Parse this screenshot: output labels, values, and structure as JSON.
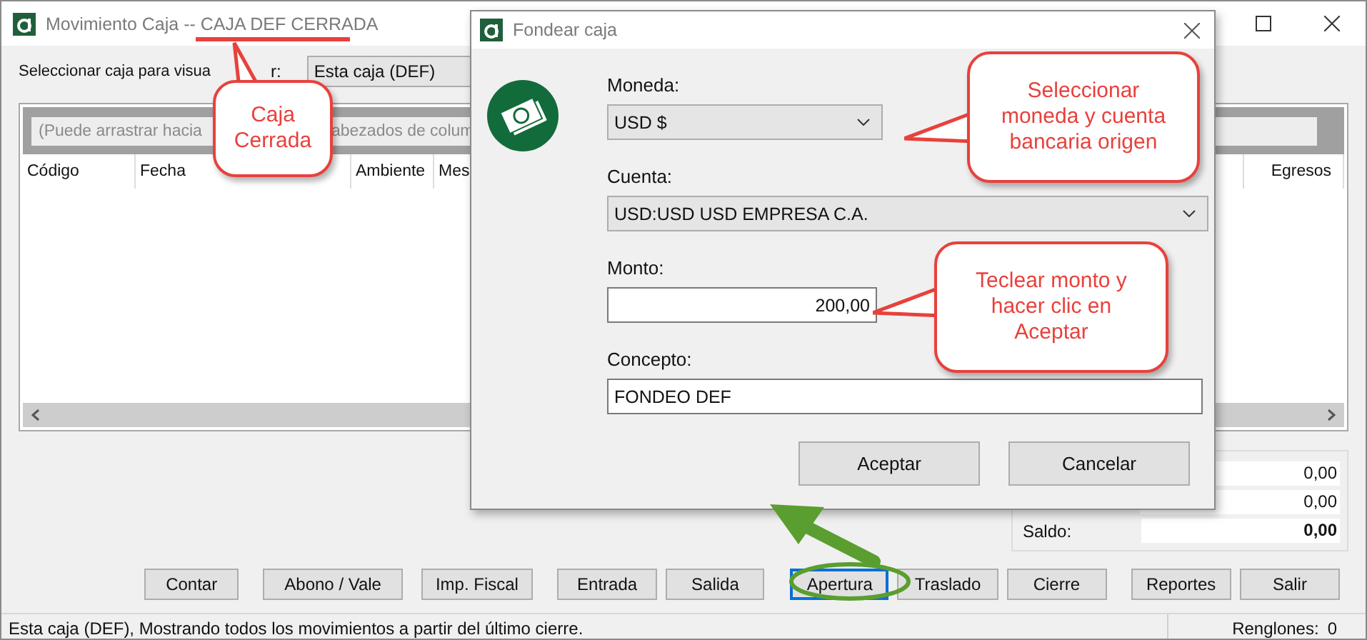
{
  "window": {
    "title": "Movimiento Caja -- ",
    "title_status": "CAJA DEF CERRADA"
  },
  "selector": {
    "label_parts": [
      "Seleccionar caja para visua",
      "r:"
    ],
    "value": "Esta caja (DEF)"
  },
  "grid": {
    "group_hint_parts": [
      "(Puede arrastrar hacia",
      "abezados de colum"
    ],
    "columns": [
      "Código",
      "Fecha",
      "Ambiente",
      "Mes",
      "Egresos"
    ]
  },
  "totals": [
    {
      "value": "0,00",
      "bold": false
    },
    {
      "value": "0,00",
      "bold": false
    },
    {
      "label": "Saldo:",
      "value": "0,00",
      "bold": true
    }
  ],
  "buttons": [
    {
      "label": "Contar",
      "focused": false
    },
    {
      "label": "Abono / Vale",
      "focused": false
    },
    {
      "label": "Imp. Fiscal",
      "focused": false
    },
    {
      "label": "Entrada",
      "focused": false
    },
    {
      "label": "Salida",
      "focused": false
    },
    {
      "label": "Apertura",
      "focused": true
    },
    {
      "label": "Traslado",
      "focused": false
    },
    {
      "label": "Cierre",
      "focused": false
    },
    {
      "label": "Reportes",
      "focused": false
    },
    {
      "label": "Salir",
      "focused": false
    }
  ],
  "status_bar": {
    "message": "Esta caja (DEF), Mostrando todos los movimientos a partir del último cierre.",
    "rows_label": "Renglones:",
    "rows_count": "0"
  },
  "dialog": {
    "title": "Fondear caja",
    "fields": [
      {
        "kind": "select",
        "label": "Moneda:",
        "value": "USD $"
      },
      {
        "kind": "select",
        "label": "Cuenta:",
        "value": "USD:USD USD EMPRESA C.A."
      },
      {
        "kind": "number",
        "label": "Monto:",
        "value": "200,00"
      },
      {
        "kind": "text",
        "label": "Concepto:",
        "value": "FONDEO DEF"
      }
    ],
    "buttons": [
      "Aceptar",
      "Cancelar"
    ]
  },
  "callouts": [
    {
      "lines": [
        "Caja",
        "Cerrada"
      ]
    },
    {
      "lines": [
        "Seleccionar",
        "moneda y cuenta",
        "bancaria origen"
      ]
    },
    {
      "lines": [
        "Teclear monto y",
        "hacer clic en",
        "Aceptar"
      ]
    }
  ]
}
